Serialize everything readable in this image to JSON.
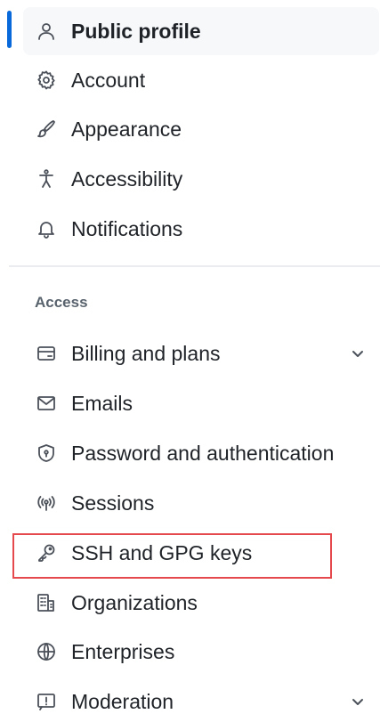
{
  "nav": {
    "active_color": "#0969da",
    "main_items": [
      {
        "label": "Public profile",
        "icon": "person-icon",
        "active": true
      },
      {
        "label": "Account",
        "icon": "gear-icon"
      },
      {
        "label": "Appearance",
        "icon": "paintbrush-icon"
      },
      {
        "label": "Accessibility",
        "icon": "accessibility-icon"
      },
      {
        "label": "Notifications",
        "icon": "bell-icon"
      }
    ],
    "access_section": {
      "heading": "Access",
      "items": [
        {
          "label": "Billing and plans",
          "icon": "credit-card-icon",
          "has_chevron": true
        },
        {
          "label": "Emails",
          "icon": "mail-icon"
        },
        {
          "label": "Password and authentication",
          "icon": "shield-lock-icon"
        },
        {
          "label": "Sessions",
          "icon": "broadcast-icon"
        },
        {
          "label": "SSH and GPG keys",
          "icon": "key-icon",
          "highlighted": true
        },
        {
          "label": "Organizations",
          "icon": "organization-icon"
        },
        {
          "label": "Enterprises",
          "icon": "globe-icon"
        },
        {
          "label": "Moderation",
          "icon": "report-icon",
          "has_chevron": true
        }
      ]
    },
    "highlight_color": "#e5484d"
  }
}
